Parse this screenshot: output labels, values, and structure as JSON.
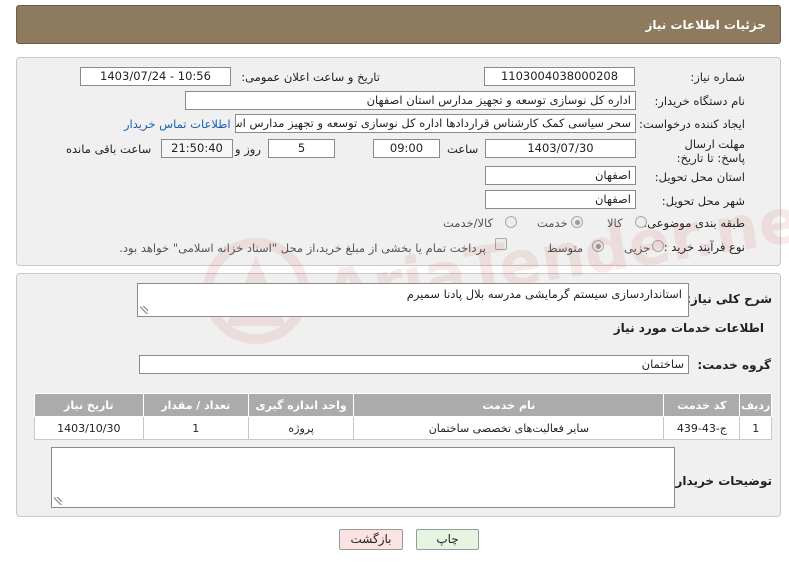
{
  "header": {
    "title": "جزئیات اطلاعات نیاز"
  },
  "form": {
    "need_number": {
      "label": "شماره نیاز:",
      "value": "1103004038000208"
    },
    "announce": {
      "label": "تاریخ و ساعت اعلان عمومی:",
      "value": "1403/07/24 - 10:56"
    },
    "buyer_org": {
      "label": "نام دستگاه خریدار:",
      "value": "اداره کل نوسازی  توسعه و تجهیز مدارس استان اصفهان"
    },
    "requester": {
      "label": "ایجاد کننده درخواست:",
      "value": "سحر سیاسی کمک کارشناس قراردادها اداره کل نوسازی  توسعه و تجهیز مدارس استان اصفهان",
      "contact_link": "اطلاعات تماس خریدار"
    },
    "deadline": {
      "label": "مهلت ارسال پاسخ: تا تاریخ:",
      "date": "1403/07/30",
      "time_label": "ساعت",
      "time": "09:00",
      "days": "5",
      "days_label": "روز و",
      "remaining": "21:50:40",
      "remaining_label": "ساعت باقی مانده"
    },
    "province": {
      "label": "استان محل تحویل:",
      "value": "اصفهان"
    },
    "city": {
      "label": "شهر محل تحویل:",
      "value": "اصفهان"
    },
    "category": {
      "label": "طبقه بندی موضوعی:",
      "options": [
        "کالا",
        "خدمت",
        "کالا/خدمت"
      ],
      "selected": "خدمت"
    },
    "process": {
      "label": "نوع فرآیند خرید :",
      "options": [
        "جزیی",
        "متوسط"
      ],
      "selected": "متوسط",
      "payment_note": "پرداخت تمام یا بخشی از مبلغ خرید،از محل \"اسناد خزانه اسلامی\" خواهد بود."
    }
  },
  "summary": {
    "label": "شرح کلی نیاز:",
    "value": "استانداردسازی سیستم گرمایشی مدرسه بلال پادنا سمیرم"
  },
  "services": {
    "section_title": "اطلاعات خدمات مورد نیاز",
    "group_label": "گروه خدمت:",
    "group_value": "ساختمان",
    "columns": [
      "ردیف",
      "کد خدمت",
      "نام خدمت",
      "واحد اندازه گیری",
      "تعداد / مقدار",
      "تاریخ نیاز"
    ],
    "rows": [
      {
        "row": "1",
        "code": "ج-43-439",
        "name": "سایر فعالیت‌های تخصصی ساختمان",
        "unit": "پروژه",
        "qty": "1",
        "date": "1403/10/30"
      }
    ]
  },
  "buyer_notes": {
    "label": "توضیحات خریدار:",
    "value": ""
  },
  "buttons": {
    "print": "چاپ",
    "back": "بازگشت"
  },
  "watermark": {
    "text": "AriaTender.neT"
  },
  "colors": {
    "header_bg": "#8e7a5e",
    "table_header_bg": "#ababab",
    "link": "#1a5fb4",
    "print_btn_bg": "#e6f5e2",
    "back_btn_bg": "#fbe3e3"
  }
}
